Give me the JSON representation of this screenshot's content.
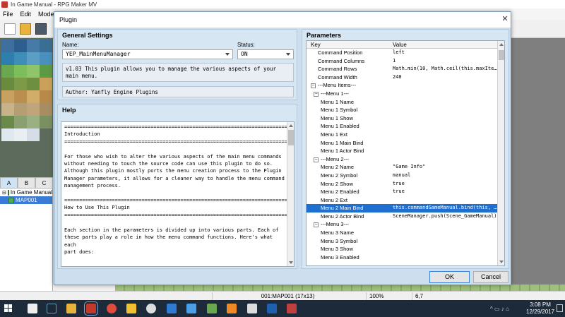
{
  "app": {
    "title": "In Game Manual - RPG Maker MV",
    "menu": [
      "File",
      "Edit",
      "Mode"
    ]
  },
  "map_tabs": [
    "A",
    "B",
    "C"
  ],
  "map_tree": [
    {
      "label": "In Game Manual",
      "selected": false
    },
    {
      "label": "MAP001",
      "selected": true
    }
  ],
  "status": {
    "map": "001:MAP001 (17x13)",
    "zoom": "100%",
    "coords": "6,7"
  },
  "taskbar": {
    "time": "3:08 PM",
    "date": "12/29/2017"
  },
  "dialog": {
    "title": "Plugin",
    "general": {
      "title": "General Settings",
      "name_label": "Name:",
      "name_value": "YEP_MainMenuManager",
      "status_label": "Status:",
      "status_value": "ON",
      "description": "v1.03 This plugin allows you to manage the various aspects of your main menu.",
      "author": "Author: Yanfly Engine Plugins"
    },
    "help": {
      "title": "Help",
      "text": "============================================================================\nIntroduction\n============================================================================\n\nFor those who wish to alter the various aspects of the main menu commands\nwithout needing to touch the source code can use this plugin to do so.\nAlthough this plugin mostly ports the menu creation process to the Plugin\nManager parameters, it allows for a cleaner way to handle the menu command\nmanagement process.\n\n============================================================================\nHow to Use This Plugin\n============================================================================\n\nEach section in the parameters is divided up into various parts. Each of\nthese parts play a role in how the menu command functions. Here's what each\npart does:"
    },
    "parameters": {
      "title": "Parameters",
      "col_key": "Key",
      "col_value": "Value",
      "rows": [
        {
          "key": "Command Position",
          "value": "left",
          "level": 2
        },
        {
          "key": "Command Columns",
          "value": "1",
          "level": 2
        },
        {
          "key": "Command Rows",
          "value": "Math.min(10, Math.ceil(this.maxIte…",
          "level": 2
        },
        {
          "key": "Command Width",
          "value": "240",
          "level": 2
        },
        {
          "key": "---Menu Items---",
          "value": "",
          "level": 0,
          "expander": "−"
        },
        {
          "key": "---Menu 1---",
          "value": "",
          "level": 1,
          "expander": "−"
        },
        {
          "key": "Menu 1 Name",
          "value": "",
          "level": 3
        },
        {
          "key": "Menu 1 Symbol",
          "value": "",
          "level": 3
        },
        {
          "key": "Menu 1 Show",
          "value": "",
          "level": 3
        },
        {
          "key": "Menu 1 Enabled",
          "value": "",
          "level": 3
        },
        {
          "key": "Menu 1 Ext",
          "value": "",
          "level": 3
        },
        {
          "key": "Menu 1 Main Bind",
          "value": "",
          "level": 3
        },
        {
          "key": "Menu 1 Actor Bind",
          "value": "",
          "level": 3
        },
        {
          "key": "---Menu 2---",
          "value": "",
          "level": 1,
          "expander": "−"
        },
        {
          "key": "Menu 2 Name",
          "value": "\"Game Info\"",
          "level": 3
        },
        {
          "key": "Menu 2 Symbol",
          "value": "manual",
          "level": 3
        },
        {
          "key": "Menu 2 Show",
          "value": "true",
          "level": 3
        },
        {
          "key": "Menu 2 Enabled",
          "value": "true",
          "level": 3
        },
        {
          "key": "Menu 2 Ext",
          "value": "",
          "level": 3
        },
        {
          "key": "Menu 2 Main Bind",
          "value": "this.commandGameManual.bind(this, …",
          "level": 3,
          "selected": true
        },
        {
          "key": "Menu 2 Actor Bind",
          "value": "SceneManager.push(Scene_GameManual)",
          "level": 3
        },
        {
          "key": "---Menu 3---",
          "value": "",
          "level": 1,
          "expander": "−"
        },
        {
          "key": "Menu 3 Name",
          "value": "",
          "level": 3
        },
        {
          "key": "Menu 3 Symbol",
          "value": "",
          "level": 3
        },
        {
          "key": "Menu 3 Show",
          "value": "",
          "level": 3
        },
        {
          "key": "Menu 3 Enabled",
          "value": "",
          "level": 3
        }
      ]
    },
    "ok_label": "OK",
    "cancel_label": "Cancel"
  }
}
